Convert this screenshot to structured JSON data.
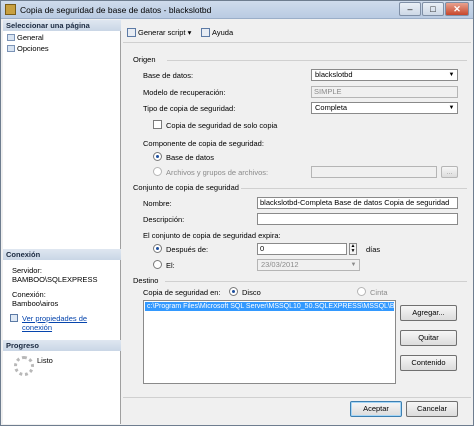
{
  "window": {
    "title": "Copia de seguridad de base de datos - blackslotbd",
    "minimize": "–",
    "maximize": "□",
    "close": "✕"
  },
  "left": {
    "select_page_heading": "Seleccionar una página",
    "pages": [
      {
        "label": "General",
        "icon": "page-icon"
      },
      {
        "label": "Opciones",
        "icon": "page-icon"
      }
    ],
    "connection_heading": "Conexión",
    "server_label": "Servidor:",
    "server_value": "BAMBOO\\SQLEXPRESS",
    "connection_label": "Conexión:",
    "connection_value": "Bamboo\\airos",
    "view_props_line1": "Ver propiedades de",
    "view_props_line2": "conexión",
    "progress_heading": "Progreso",
    "progress_status": "Listo"
  },
  "toolbar": {
    "script_label": "Generar script",
    "script_arrow": "▾",
    "help_label": "Ayuda"
  },
  "origin": {
    "heading": "Origen",
    "database_label": "Base de datos:",
    "database_value": "blackslotbd",
    "recovery_label": "Modelo de recuperación:",
    "recovery_value": "SIMPLE",
    "backup_type_label": "Tipo de copia de seguridad:",
    "backup_type_value": "Completa",
    "copy_only_label": "Copia de seguridad de solo copia",
    "copy_only_checked": false,
    "component_label": "Componente de copia de seguridad:",
    "component_db_label": "Base de datos",
    "component_files_label": "Archivos y grupos de archivos:",
    "browse_label": "..."
  },
  "backup_set": {
    "heading": "Conjunto de copia de seguridad",
    "name_label": "Nombre:",
    "name_value": "blackslotbd-Completa Base de datos Copia de seguridad",
    "description_label": "Descripción:",
    "description_value": "",
    "expires_label": "El conjunto de copia de seguridad expira:",
    "after_label": "Después de:",
    "after_value": "0",
    "days_label": "días",
    "on_label": "El:",
    "on_value": "23/03/2012"
  },
  "destination": {
    "heading": "Destino",
    "backup_to_label": "Copia de seguridad en:",
    "disk_label": "Disco",
    "tape_label": "Cinta",
    "paths": [
      "c:\\Program Files\\Microsoft SQL Server\\MSSQL10_50.SQLEXPRESS\\MSSQL\\Backup\\blackslotbd.bak"
    ],
    "add_label": "Agregar...",
    "remove_label": "Quitar",
    "contents_label": "Contenido"
  },
  "footer": {
    "accept_label": "Aceptar",
    "cancel_label": "Cancelar"
  }
}
